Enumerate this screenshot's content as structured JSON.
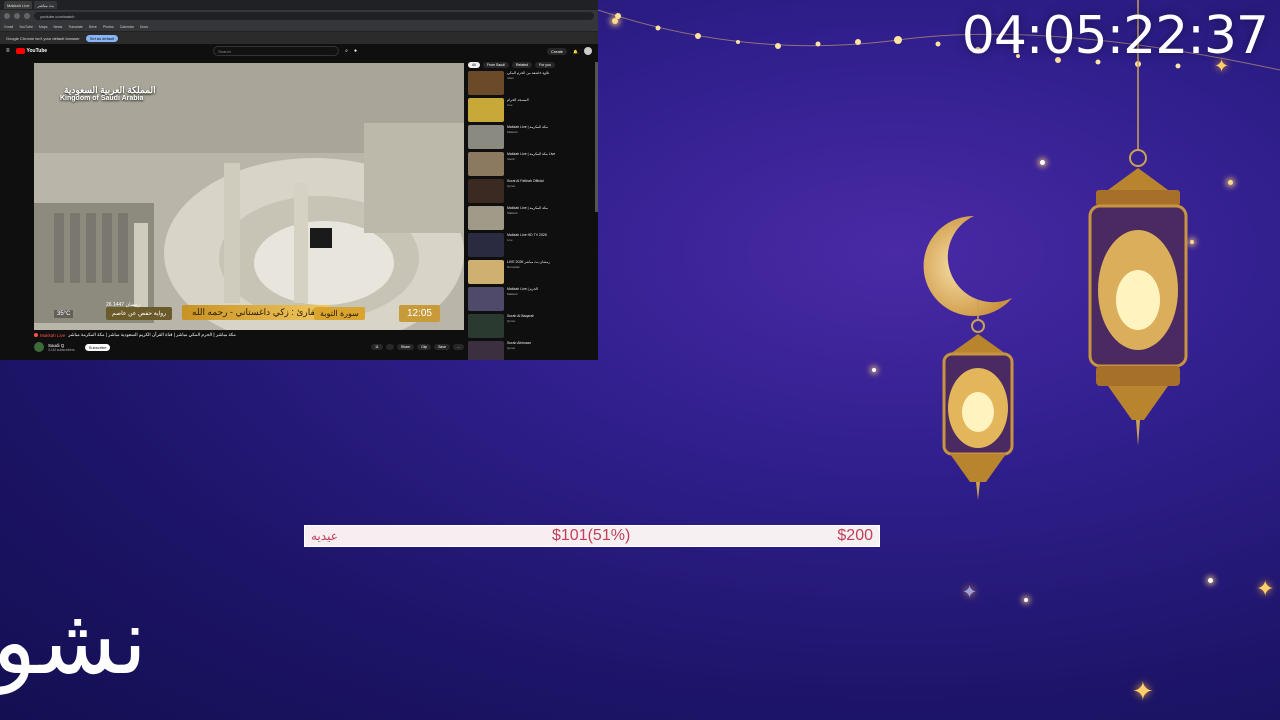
{
  "overlay": {
    "countdown": "04:05:22:37",
    "goal": {
      "label": "عيديه",
      "current": "$101(51%)",
      "target": "$200",
      "progress_fraction": 0.505
    },
    "ticker_text": "نشو",
    "colors": {
      "goal_text": "#c0405a",
      "background": "#2e1e8a"
    }
  },
  "browser": {
    "tabs": [
      {
        "label": "Makkah Live"
      },
      {
        "label": "بث مباشر"
      }
    ],
    "url": "youtube.com/watch",
    "bookmarks": [
      "Gmail",
      "YouTube",
      "Maps",
      "News",
      "Translate",
      "Drive",
      "Photos",
      "Calendar",
      "Docs"
    ],
    "infobar": {
      "text": "Google Chrome isn't your default browser",
      "button": "Set as default"
    },
    "youtube": {
      "logo": "YouTube",
      "search_placeholder": "Search",
      "create_label": "Create",
      "video": {
        "overlay_ar": "المملكة العربية السعودية",
        "overlay_en": "Kingdom of Saudi Arabia",
        "surah": "سورة التوبة",
        "reciter": "القارئ : زكي داغستاني - رحمه الله",
        "riwaya": "رواية حفص عن عاصم",
        "date": "26 رمضان 1447",
        "temperature": "35°C",
        "time": "12:05"
      },
      "title": "مكة مباشر | الحرم المكي مباشر | قناة القرآن الكريم السعودية مباشر | مكة المكرمة مباشر",
      "live_label": "Makkah Live",
      "channel": "Saudi Q",
      "subscribers": "3.1M subscribers",
      "subscribe_label": "Subscribe",
      "actions": [
        "11",
        "",
        "Share",
        "Clip",
        "Save",
        "..."
      ],
      "chips": [
        "All",
        "From Saudi",
        "Related",
        "For you"
      ],
      "recommendations": [
        {
          "title": "تلاوة خاشعة من الحرم المكي",
          "channel": "Islam",
          "color": "#6b4a2a"
        },
        {
          "title": "المسجد الحرام",
          "channel": "Live",
          "color": "#c8a838"
        },
        {
          "title": "Makkah Live | مكة المكرمة",
          "channel": "Makkah",
          "color": "#8a8a80"
        },
        {
          "title": "Makkah Live | مكة المكرمة Live",
          "channel": "Saudi",
          "color": "#8c7a60"
        },
        {
          "title": "Surat Al Fatihah Official",
          "channel": "Quran",
          "color": "#3a2a22"
        },
        {
          "title": "Makkah Live | مكة المكرمة",
          "channel": "Makkah",
          "color": "#a09a88"
        },
        {
          "title": "Makkah Live HD TV 2026",
          "channel": "Live",
          "color": "#2a2a40"
        },
        {
          "title": "LIVE 2026 رمضان بث مباشر",
          "channel": "Ramadan",
          "color": "#d0b070"
        },
        {
          "title": "Makkah Live | الحرم",
          "channel": "Makkah",
          "color": "#504a6a"
        },
        {
          "title": "Surah Al Baqarah",
          "channel": "Quran",
          "color": "#2a3a30"
        },
        {
          "title": "Surah Alimraan",
          "channel": "Quran",
          "color": "#3a3040"
        }
      ]
    }
  }
}
